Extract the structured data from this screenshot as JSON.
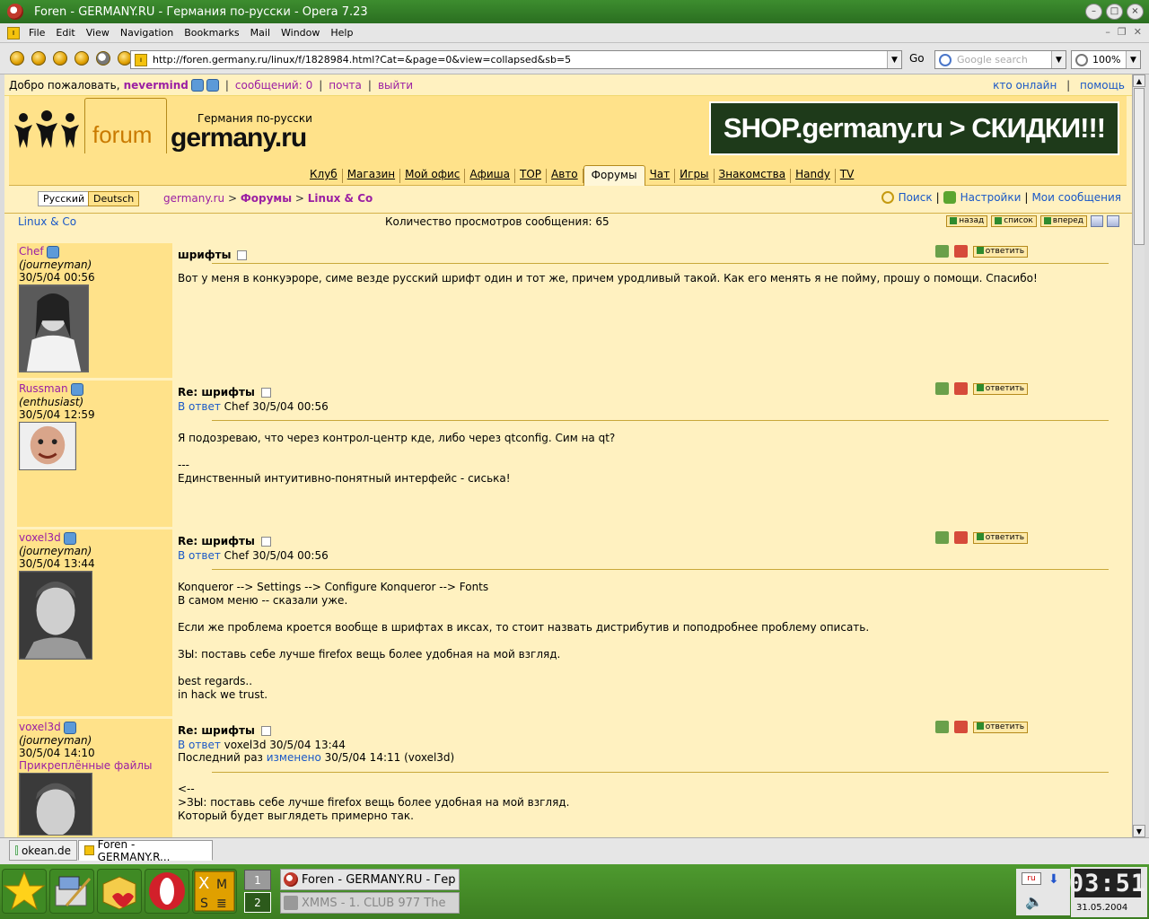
{
  "window": {
    "title": "Foren - GERMANY.RU - Германия по-русски - Opera 7.23"
  },
  "menu": [
    "File",
    "Edit",
    "View",
    "Navigation",
    "Bookmarks",
    "Mail",
    "Window",
    "Help"
  ],
  "toolbar": {
    "url": "http://foren.germany.ru/linux/f/1828984.html?Cat=&page=0&view=collapsed&sb=5",
    "go_label": "Go",
    "search_placeholder": "Google search",
    "zoom": "100%"
  },
  "infobar": {
    "welcome": "Добро пожаловать,",
    "nick": "nevermind",
    "messages": "сообщений: 0",
    "mail": "почта",
    "logout": "выйти",
    "who_online": "кто онлайн",
    "help": "помощь"
  },
  "header": {
    "tab_label": "forum",
    "tagline": "Германия по-русски",
    "brand": "germany.ru",
    "banner": "SHOP.germany.ru > СКИДКИ!!!"
  },
  "navtabs": [
    "Клуб",
    "Магазин",
    "Мой офис",
    "Афиша",
    "TOP",
    "Авто",
    "Форумы",
    "Чат",
    "Игры",
    "Знакомства",
    "Handy",
    "TV"
  ],
  "crumbs": {
    "lang_ru": "Русский",
    "lang_de": "Deutsch",
    "site": "germany.ru",
    "sep": ">",
    "forums": "Форумы",
    "board": "Linux & Co",
    "search": "Поиск",
    "settings": "Настройки",
    "my_messages": "Мои сообщения"
  },
  "subrow": {
    "board": "Linux & Co",
    "views": "Количество просмотров сообщения: 65",
    "back": "назад",
    "list": "список",
    "forward": "вперед"
  },
  "posts": [
    {
      "author": "Chef",
      "rank": "(journeyman)",
      "date": "30/5/04 00:56",
      "title": "шрифты",
      "reply_to_label": "",
      "reply_to": "",
      "edited": "",
      "reply_btn": "ответить",
      "text": "Вот у меня в конкуэроре, симе везде русский шрифт один и тот же, причем уродливый такой. Как его менять я не пойму, прошу о помощи. Спасибо!"
    },
    {
      "author": "Russman",
      "rank": "(enthusiast)",
      "date": "30/5/04 12:59",
      "title": "Re: шрифты",
      "reply_to_label": "В ответ",
      "reply_to": "Chef 30/5/04 00:56",
      "reply_btn": "ответить",
      "text": "Я подозреваю, что через контрол-центр кде, либо через qtconfig. Сим на qt?\n\n---\nЕдинственный интуитивно-понятный интерфейс - сиська!"
    },
    {
      "author": "voxel3d",
      "rank": "(journeyman)",
      "date": "30/5/04 13:44",
      "title": "Re: шрифты",
      "reply_to_label": "В ответ",
      "reply_to": "Chef 30/5/04 00:56",
      "reply_btn": "ответить",
      "text": "Konqueror --> Settings --> Configure Konqueror --> Fonts\nВ самом меню -- сказали уже.\n\nЕсли же проблема кроется вообще в шрифтах в иксах, то стоит назвать дистрибутив и поподробнее проблему описать.\n\nЗЫ: поставь себе лучше firefox вещь более удобная на мой взгляд.\n\nbest regards..\nin hack we trust."
    },
    {
      "author": "voxel3d",
      "rank": "(journeyman)",
      "date": "30/5/04 14:10",
      "attachments": "Прикреплённые файлы",
      "title": "Re: шрифты",
      "reply_to_label": "В ответ",
      "reply_to": "voxel3d 30/5/04 13:44",
      "edited_prefix": "Последний раз",
      "edited_link": "изменено",
      "edited_suffix": "30/5/04 14:11 (voxel3d)",
      "reply_btn": "ответить",
      "text": "<--\n>ЗЫ: поставь себе лучше firefox вещь более удобная на мой взгляд.\nКоторый будет выглядеть примерно так."
    }
  ],
  "tabs": [
    "okean.de",
    "Foren - GERMANY.R..."
  ],
  "taskbar": {
    "pager": [
      "1",
      "2"
    ],
    "tasks": [
      "Foren - GERMANY.RU - Гер",
      "XMMS - 1.  CLUB 977 The"
    ],
    "tray_lang": "ru",
    "time": "03:51",
    "date": "31.05.2004"
  }
}
